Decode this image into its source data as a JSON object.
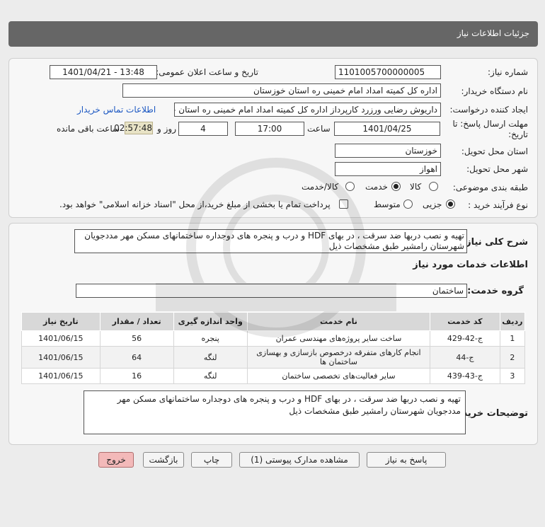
{
  "header": {
    "title": "جزئیات اطلاعات نیاز"
  },
  "info": {
    "need_number_label": "شماره نیاز:",
    "need_number": "1101005700000005",
    "announce_label": "تاریخ و ساعت اعلان عمومی:",
    "announce_value": "1401/04/21 - 13:48",
    "buyer_org_label": "نام دستگاه خریدار:",
    "buyer_org": "اداره کل کمیته امداد امام خمینی  ره  استان خوزستان",
    "creator_label": "ایجاد کننده درخواست:",
    "creator": "داریوش رضایی ورزرد کارپرداز اداره کل کمیته امداد امام خمینی  ره  استان خوزستان",
    "contact_link": "اطلاعات تماس خریدار",
    "deadline_label_1": "مهلت ارسال پاسخ: تا",
    "deadline_label_2": "تاریخ:",
    "deadline_date": "1401/04/25",
    "time_label": "ساعت",
    "deadline_time": "17:00",
    "days_value": "4",
    "days_label": "روز و",
    "remaining_time": "02:57:48",
    "remaining_label": "ساعت باقی مانده",
    "province_label": "استان محل تحویل:",
    "province": "خوزستان",
    "city_label": "شهر محل تحویل:",
    "city": "اهواز",
    "category_label": "طبقه بندی موضوعی:",
    "category_options": [
      "کالا",
      "خدمت",
      "کالا/خدمت"
    ],
    "category_selected": "خدمت",
    "process_label": "نوع فرآیند خرید :",
    "process_options": [
      "جزیی",
      "متوسط"
    ],
    "process_selected": "جزیی",
    "payment_note": "پرداخت تمام یا بخشی از مبلغ خرید،از محل \"اسناد خزانه اسلامی\" خواهد بود."
  },
  "details": {
    "summary_label": "شرح کلی نیاز:",
    "summary": "تهیه و نصب دربها ضد سرقت ، در بهای HDF  و درب و پنجره های دوجداره ساختمانهای مسکن مهر مددجویان شهرستان رامشیر طبق مشخصات ذیل",
    "services_heading": "اطلاعات خدمات مورد نیاز",
    "service_group_label": "گروه خدمت:",
    "service_group": "ساختمان",
    "table": {
      "headers": [
        "ردیف",
        "کد خدمت",
        "نام خدمت",
        "واحد اندازه گیری",
        "تعداد / مقدار",
        "تاریخ نیاز"
      ],
      "rows": [
        [
          "1",
          "ج-42-429",
          "ساخت سایر پروژه‌های مهندسی عمران",
          "پنجره",
          "56",
          "1401/06/15"
        ],
        [
          "2",
          "ج-44",
          "انجام کارهای متفرقه درخصوص بازسازی و بهسازی ساختمان ها",
          "لنگه",
          "64",
          "1401/06/15"
        ],
        [
          "3",
          "ج-43-439",
          "سایر فعالیت‌های تخصصی ساختمان",
          "لنگه",
          "16",
          "1401/06/15"
        ]
      ]
    },
    "buyer_notes_label": "توضیحات خریدار:",
    "buyer_notes": "تهیه و نصب دربها ضد سرقت ، در بهای HDF  و درب و پنجره های دوجداره ساختمانهای مسکن مهر مددجویان شهرستان رامشیر طبق مشخصات ذیل"
  },
  "buttons": {
    "reply": "پاسخ به نیاز",
    "view_docs": "مشاهده مدارک پیوستی (1)",
    "print": "چاپ",
    "back": "بازگشت",
    "exit": "خروج"
  },
  "colors": {
    "header_bg": "#666666",
    "link": "#1b57c2",
    "exit_button": "#f3b9b9"
  }
}
